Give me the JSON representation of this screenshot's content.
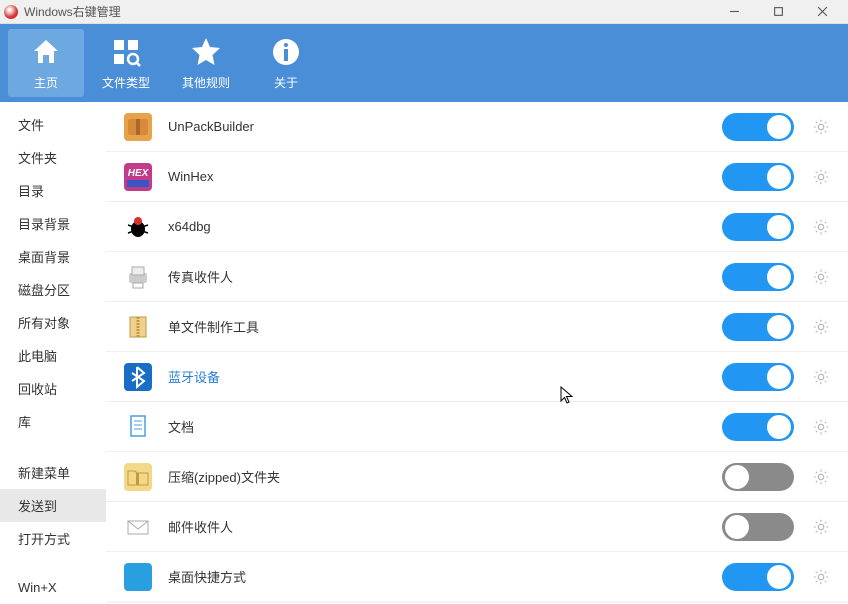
{
  "window": {
    "title": "Windows右键管理"
  },
  "toolbar": [
    {
      "id": "home",
      "label": "主页",
      "active": true
    },
    {
      "id": "filetype",
      "label": "文件类型",
      "active": false
    },
    {
      "id": "other",
      "label": "其他规则",
      "active": false
    },
    {
      "id": "about",
      "label": "关于",
      "active": false
    }
  ],
  "sidebar": {
    "groups": [
      [
        "文件",
        "文件夹",
        "目录",
        "目录背景",
        "桌面背景",
        "磁盘分区",
        "所有对象",
        "此电脑",
        "回收站",
        "库"
      ],
      [
        "新建菜单",
        "发送到",
        "打开方式"
      ],
      [
        "Win+X"
      ]
    ],
    "active": "发送到"
  },
  "items": [
    {
      "label": "UnPackBuilder",
      "on": true,
      "iconBg": "#e8a24a",
      "iconFg": "#fff",
      "glyph": "pack"
    },
    {
      "label": "WinHex",
      "on": true,
      "iconBg": "#c23a8a",
      "iconFg": "#fff",
      "glyph": "hex"
    },
    {
      "label": "x64dbg",
      "on": true,
      "iconBg": "transparent",
      "iconFg": "#000",
      "glyph": "bug"
    },
    {
      "label": "传真收件人",
      "on": true,
      "iconBg": "transparent",
      "iconFg": "#888",
      "glyph": "fax"
    },
    {
      "label": "单文件制作工具",
      "on": true,
      "iconBg": "transparent",
      "iconFg": "#d6a23a",
      "glyph": "zip"
    },
    {
      "label": "蓝牙设备",
      "on": true,
      "iconBg": "#1a6dc4",
      "iconFg": "#fff",
      "glyph": "bt",
      "highlight": true
    },
    {
      "label": "文档",
      "on": true,
      "iconBg": "transparent",
      "iconFg": "#4a9fe0",
      "glyph": "doc"
    },
    {
      "label": "压缩(zipped)文件夹",
      "on": false,
      "iconBg": "#f2d98a",
      "iconFg": "#c49a3a",
      "glyph": "folder"
    },
    {
      "label": "邮件收件人",
      "on": false,
      "iconBg": "transparent",
      "iconFg": "#888",
      "glyph": "mail"
    },
    {
      "label": "桌面快捷方式",
      "on": true,
      "iconBg": "#2a9fe0",
      "iconFg": "#fff",
      "glyph": "desk"
    }
  ]
}
